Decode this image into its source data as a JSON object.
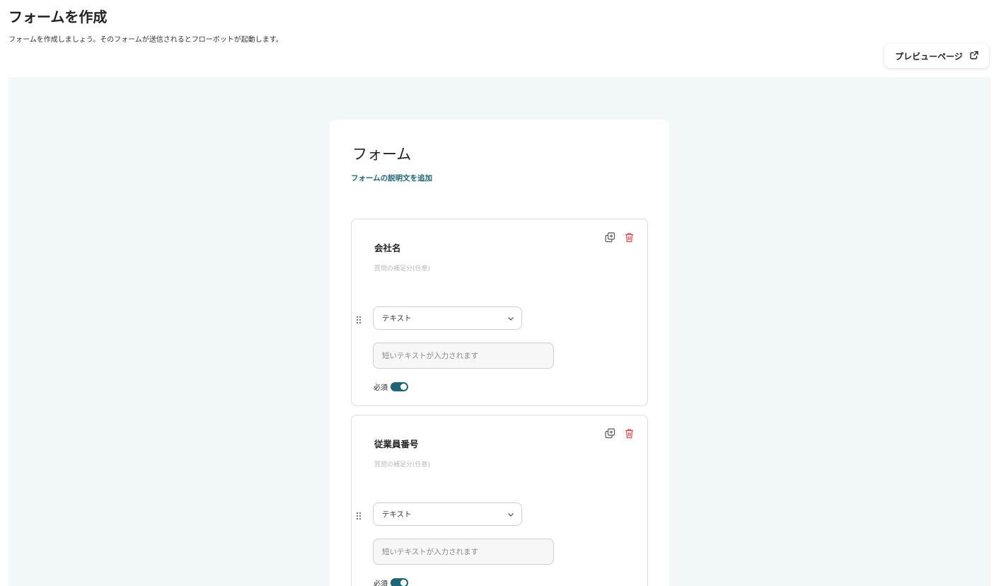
{
  "header": {
    "title": "フォームを作成",
    "description": "フォームを作成しましょう。そのフォームが送信されるとフローボットが起動します。",
    "preview_label": "プレビューページ"
  },
  "form": {
    "title": "フォーム",
    "add_description_label": "フォームの説明文を追加",
    "questions": [
      {
        "title": "会社名",
        "subtitle": "質問の補足分(任意)",
        "type": "テキスト",
        "answer_placeholder": "短いテキストが入力されます",
        "required_label": "必須",
        "required": true
      },
      {
        "title": "従業員番号",
        "subtitle": "質問の補足分(任意)",
        "type": "テキスト",
        "answer_placeholder": "短いテキストが入力されます",
        "required_label": "必須",
        "required": true
      }
    ]
  },
  "colors": {
    "accent": "#1d6577",
    "canvas_bg": "#f2f8f7",
    "delete": "#e0444b"
  },
  "icons": [
    "external-link-icon",
    "duplicate-icon",
    "trash-icon",
    "drag-handle-icon",
    "chevron-down-icon"
  ]
}
